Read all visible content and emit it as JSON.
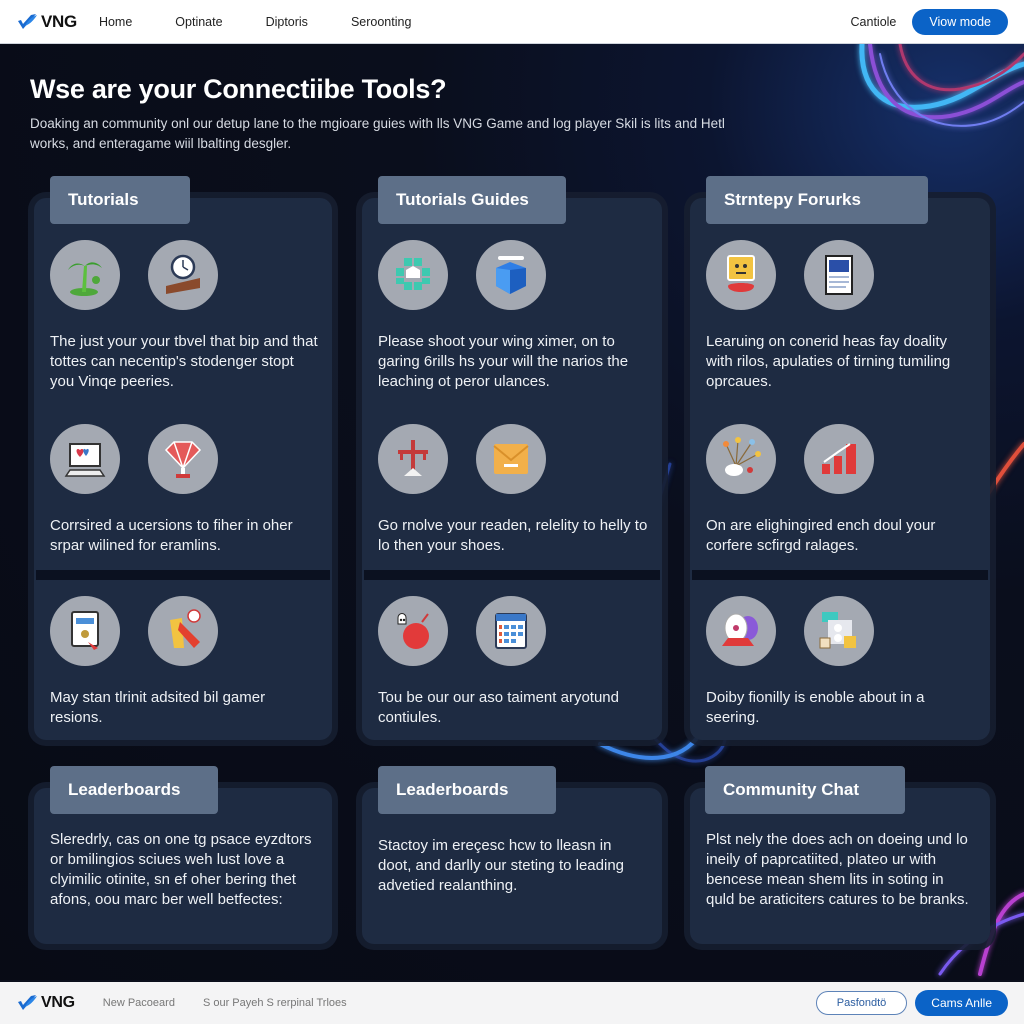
{
  "header": {
    "brand": "VNG",
    "nav": [
      "Home",
      "Optinate",
      "Diptoris",
      "Seroonting"
    ],
    "link_label": "Cantiole",
    "primary_label": "Viow mode"
  },
  "hero": {
    "title": "Wse are your Connectiibe Tools?",
    "subtitle": "Doaking an community onl our detup lane to the mgioare guies with lls VNG Game and log player Skil is lits and Hetl works, and enteragame wiil lbalting desgler."
  },
  "cards": [
    {
      "title": "Tutorials",
      "sections": [
        {
          "icons": [
            "palm-tree-icon",
            "clock-icon"
          ],
          "text": "The just your your tbvel that bip and that tottes can necentip's stodenger stopt you Vinqe peeries."
        },
        {
          "icons": [
            "monitor-heart-icon",
            "gem-icon"
          ],
          "text": "Corrsired a ucersions to fiher in oher srpar wilined for eramlins."
        },
        {
          "icons": [
            "tablet-cursor-icon",
            "flag-icon"
          ],
          "text": "May stan tlrinit adsited bil gamer resions."
        }
      ]
    },
    {
      "title": "Tutorials Guides",
      "sections": [
        {
          "icons": [
            "puzzle-badge-icon",
            "cube-icon"
          ],
          "text": "Please shoot your wing ximer, on to garing 6rills hs your will the narios the leaching ot peror ulances."
        },
        {
          "icons": [
            "signpost-icon",
            "envelope-box-icon"
          ],
          "text": "Go rnolve your readen, relelity to helly to lo then your shoes."
        },
        {
          "icons": [
            "bomb-character-icon",
            "calendar-icon"
          ],
          "text": "Tou be our our aso taiment aryotund contiules."
        }
      ]
    },
    {
      "title": "Strntepy Forurks",
      "sections": [
        {
          "icons": [
            "robot-face-icon",
            "document-icon"
          ],
          "text": "Learuing on conerid heas fay doality with rilos, apulaties of tirning tumiling oprcaues."
        },
        {
          "icons": [
            "bouquet-icon",
            "bar-chart-icon"
          ],
          "text": "On are elighingired ench doul your corfere scfirgd ralages."
        },
        {
          "icons": [
            "speaker-icon",
            "locked-board-icon"
          ],
          "text": "Doiby fionilly is enoble about in a seering."
        }
      ]
    },
    {
      "title": "Leaderboards",
      "text": "Sleredrly, cas on one tg psace eyzdtors or bmilingios sciues weh lust love a clyimilic otinite, sn ef oher bering thet afons, oou marc ber well betfectes:"
    },
    {
      "title": "Leaderboards",
      "text": "Stactoy im ereçesc hcw to lleasn in doot, and darlly our steting to leading advetied realanthing."
    },
    {
      "title": "Community Chat",
      "text": "Plst nely the does ach on doeing und lo ineily of paprcatiited, plateo ur with bencese mean shem lits in soting in quld be araticiters catures to be branks."
    }
  ],
  "footer": {
    "brand": "VNG",
    "links": [
      "New Pacoeard",
      "S our Payeh S rerpinal Trloes"
    ],
    "outline_label": "Pasfondtö",
    "primary_label": "Cams Anlle"
  },
  "colors": {
    "accent": "#0b63c7",
    "card_bg": "#1e2b42",
    "tab_bg": "#5d6f88",
    "page_bg": "#0b0f1c"
  }
}
